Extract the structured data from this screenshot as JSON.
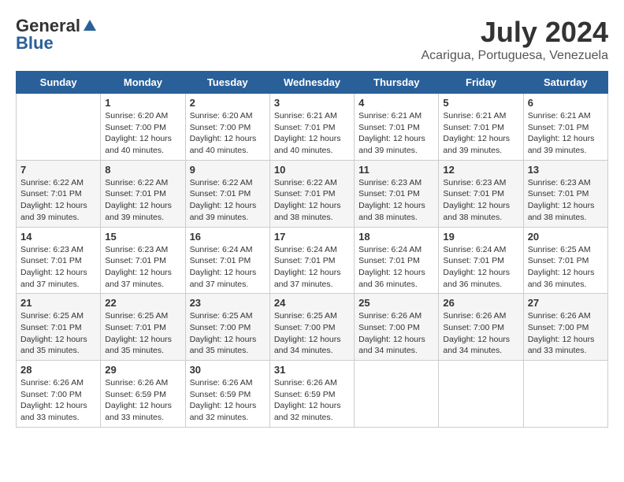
{
  "header": {
    "logo_general": "General",
    "logo_blue": "Blue",
    "title": "July 2024",
    "subtitle": "Acarigua, Portuguesa, Venezuela"
  },
  "days_of_week": [
    "Sunday",
    "Monday",
    "Tuesday",
    "Wednesday",
    "Thursday",
    "Friday",
    "Saturday"
  ],
  "weeks": [
    [
      {
        "day": "",
        "info": ""
      },
      {
        "day": "1",
        "info": "Sunrise: 6:20 AM\nSunset: 7:00 PM\nDaylight: 12 hours\nand 40 minutes."
      },
      {
        "day": "2",
        "info": "Sunrise: 6:20 AM\nSunset: 7:00 PM\nDaylight: 12 hours\nand 40 minutes."
      },
      {
        "day": "3",
        "info": "Sunrise: 6:21 AM\nSunset: 7:01 PM\nDaylight: 12 hours\nand 40 minutes."
      },
      {
        "day": "4",
        "info": "Sunrise: 6:21 AM\nSunset: 7:01 PM\nDaylight: 12 hours\nand 39 minutes."
      },
      {
        "day": "5",
        "info": "Sunrise: 6:21 AM\nSunset: 7:01 PM\nDaylight: 12 hours\nand 39 minutes."
      },
      {
        "day": "6",
        "info": "Sunrise: 6:21 AM\nSunset: 7:01 PM\nDaylight: 12 hours\nand 39 minutes."
      }
    ],
    [
      {
        "day": "7",
        "info": "Sunrise: 6:22 AM\nSunset: 7:01 PM\nDaylight: 12 hours\nand 39 minutes."
      },
      {
        "day": "8",
        "info": "Sunrise: 6:22 AM\nSunset: 7:01 PM\nDaylight: 12 hours\nand 39 minutes."
      },
      {
        "day": "9",
        "info": "Sunrise: 6:22 AM\nSunset: 7:01 PM\nDaylight: 12 hours\nand 39 minutes."
      },
      {
        "day": "10",
        "info": "Sunrise: 6:22 AM\nSunset: 7:01 PM\nDaylight: 12 hours\nand 38 minutes."
      },
      {
        "day": "11",
        "info": "Sunrise: 6:23 AM\nSunset: 7:01 PM\nDaylight: 12 hours\nand 38 minutes."
      },
      {
        "day": "12",
        "info": "Sunrise: 6:23 AM\nSunset: 7:01 PM\nDaylight: 12 hours\nand 38 minutes."
      },
      {
        "day": "13",
        "info": "Sunrise: 6:23 AM\nSunset: 7:01 PM\nDaylight: 12 hours\nand 38 minutes."
      }
    ],
    [
      {
        "day": "14",
        "info": "Sunrise: 6:23 AM\nSunset: 7:01 PM\nDaylight: 12 hours\nand 37 minutes."
      },
      {
        "day": "15",
        "info": "Sunrise: 6:23 AM\nSunset: 7:01 PM\nDaylight: 12 hours\nand 37 minutes."
      },
      {
        "day": "16",
        "info": "Sunrise: 6:24 AM\nSunset: 7:01 PM\nDaylight: 12 hours\nand 37 minutes."
      },
      {
        "day": "17",
        "info": "Sunrise: 6:24 AM\nSunset: 7:01 PM\nDaylight: 12 hours\nand 37 minutes."
      },
      {
        "day": "18",
        "info": "Sunrise: 6:24 AM\nSunset: 7:01 PM\nDaylight: 12 hours\nand 36 minutes."
      },
      {
        "day": "19",
        "info": "Sunrise: 6:24 AM\nSunset: 7:01 PM\nDaylight: 12 hours\nand 36 minutes."
      },
      {
        "day": "20",
        "info": "Sunrise: 6:25 AM\nSunset: 7:01 PM\nDaylight: 12 hours\nand 36 minutes."
      }
    ],
    [
      {
        "day": "21",
        "info": "Sunrise: 6:25 AM\nSunset: 7:01 PM\nDaylight: 12 hours\nand 35 minutes."
      },
      {
        "day": "22",
        "info": "Sunrise: 6:25 AM\nSunset: 7:01 PM\nDaylight: 12 hours\nand 35 minutes."
      },
      {
        "day": "23",
        "info": "Sunrise: 6:25 AM\nSunset: 7:00 PM\nDaylight: 12 hours\nand 35 minutes."
      },
      {
        "day": "24",
        "info": "Sunrise: 6:25 AM\nSunset: 7:00 PM\nDaylight: 12 hours\nand 34 minutes."
      },
      {
        "day": "25",
        "info": "Sunrise: 6:26 AM\nSunset: 7:00 PM\nDaylight: 12 hours\nand 34 minutes."
      },
      {
        "day": "26",
        "info": "Sunrise: 6:26 AM\nSunset: 7:00 PM\nDaylight: 12 hours\nand 34 minutes."
      },
      {
        "day": "27",
        "info": "Sunrise: 6:26 AM\nSunset: 7:00 PM\nDaylight: 12 hours\nand 33 minutes."
      }
    ],
    [
      {
        "day": "28",
        "info": "Sunrise: 6:26 AM\nSunset: 7:00 PM\nDaylight: 12 hours\nand 33 minutes."
      },
      {
        "day": "29",
        "info": "Sunrise: 6:26 AM\nSunset: 6:59 PM\nDaylight: 12 hours\nand 33 minutes."
      },
      {
        "day": "30",
        "info": "Sunrise: 6:26 AM\nSunset: 6:59 PM\nDaylight: 12 hours\nand 32 minutes."
      },
      {
        "day": "31",
        "info": "Sunrise: 6:26 AM\nSunset: 6:59 PM\nDaylight: 12 hours\nand 32 minutes."
      },
      {
        "day": "",
        "info": ""
      },
      {
        "day": "",
        "info": ""
      },
      {
        "day": "",
        "info": ""
      }
    ]
  ]
}
